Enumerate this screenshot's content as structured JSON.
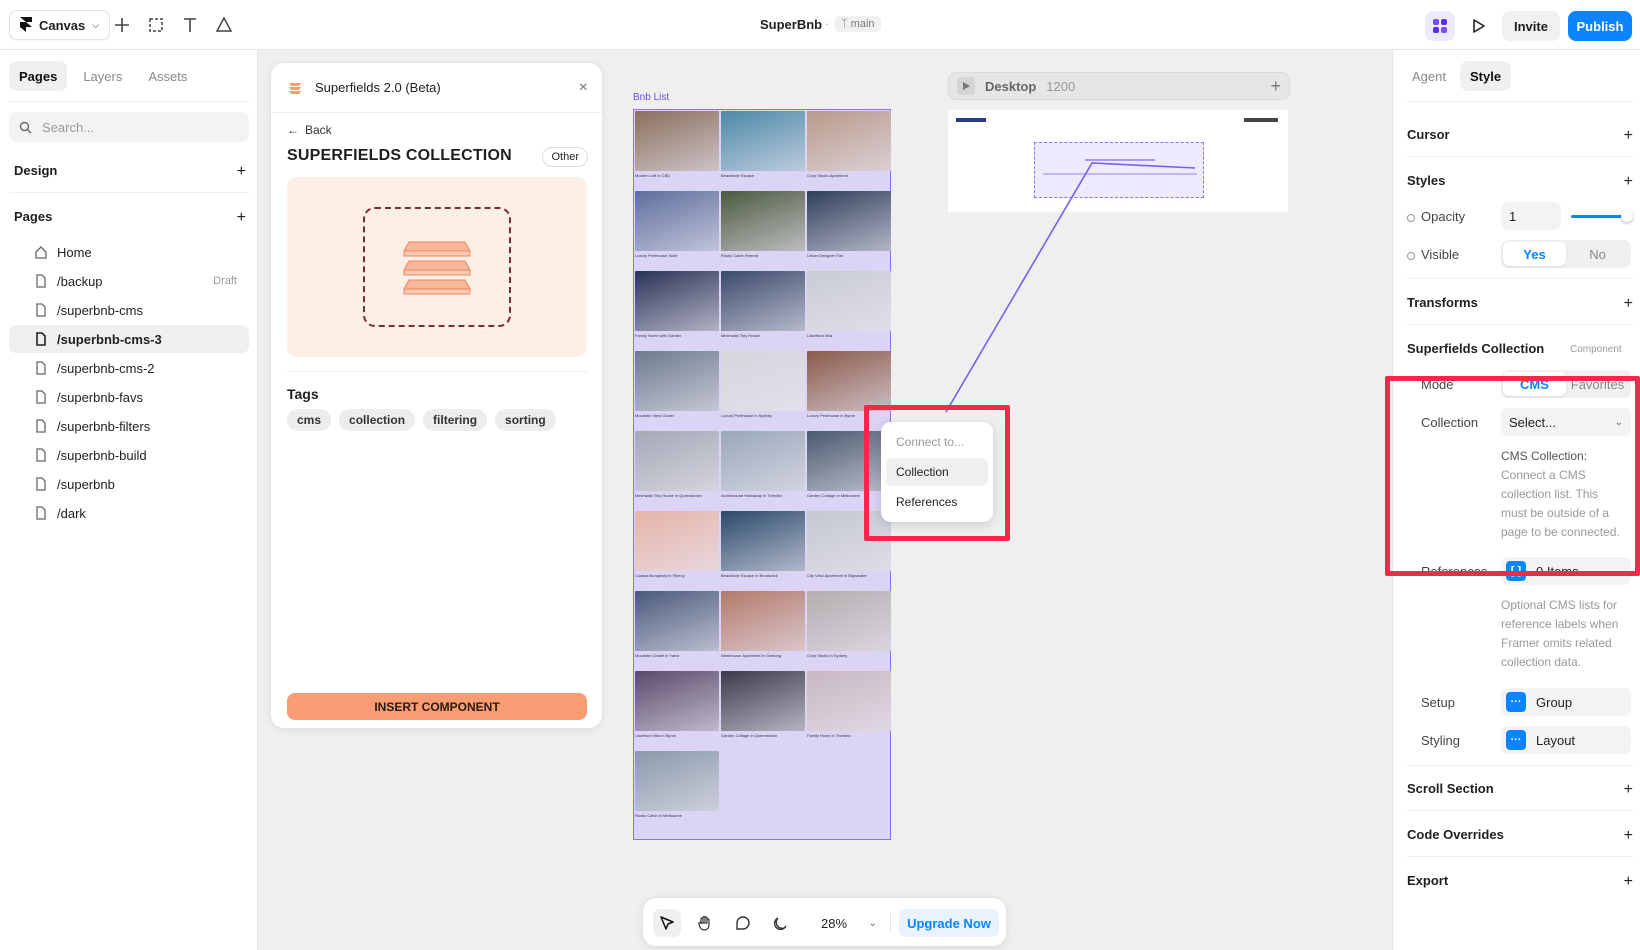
{
  "topbar": {
    "canvas_label": "Canvas",
    "project_title": "SuperBnb",
    "separator": "·",
    "branch": "main",
    "invite": "Invite",
    "publish": "Publish"
  },
  "left": {
    "tabs": [
      "Pages",
      "Layers",
      "Assets"
    ],
    "search_placeholder": "Search...",
    "design_label": "Design",
    "pages_label": "Pages",
    "pages": [
      {
        "label": "Home",
        "badge": ""
      },
      {
        "label": "/backup",
        "badge": "Draft"
      },
      {
        "label": "/superbnb-cms",
        "badge": ""
      },
      {
        "label": "/superbnb-cms-3",
        "badge": ""
      },
      {
        "label": "/superbnb-cms-2",
        "badge": ""
      },
      {
        "label": "/superbnb-favs",
        "badge": ""
      },
      {
        "label": "/superbnb-filters",
        "badge": ""
      },
      {
        "label": "/superbnb-build",
        "badge": ""
      },
      {
        "label": "/superbnb",
        "badge": ""
      },
      {
        "label": "/dark",
        "badge": ""
      }
    ]
  },
  "superfields": {
    "title": "Superfields 2.0 (Beta)",
    "back": "Back",
    "heading": "SUPERFIELDS COLLECTION",
    "category": "Other",
    "tags_label": "Tags",
    "tags": [
      "cms",
      "collection",
      "filtering",
      "sorting"
    ],
    "insert": "INSERT COMPONENT"
  },
  "canvas": {
    "bnb_label": "Bnb List",
    "cards": [
      {
        "title": "Modern Loft in CBD",
        "color": "#8a6f5c"
      },
      {
        "title": "Beachside Escape",
        "color": "#4d8aa8"
      },
      {
        "title": "Cozy Studio Apartment",
        "color": "#b99a8a"
      },
      {
        "title": "Luxury Penthouse Suite",
        "color": "#5e6f9c"
      },
      {
        "title": "Rustic Cabin Retreat",
        "color": "#4c5a3f"
      },
      {
        "title": "Urban Designer Flat",
        "color": "#2f3f5a"
      },
      {
        "title": "Family Home with Garden",
        "color": "#2a3355"
      },
      {
        "title": "Minimalist Tiny House",
        "color": "#3a4a6a"
      },
      {
        "title": "Lakefront Villa",
        "color": "#c9ccd4"
      },
      {
        "title": "Mountain View Chalet",
        "color": "#6d7c8c"
      },
      {
        "title": "Luxury Penthouse in Sydney",
        "color": "#d7d4dc"
      },
      {
        "title": "Luxury Penthouse in Byron",
        "color": "#8a5a4a"
      },
      {
        "title": "Minimalist Tiny House in Queenstown",
        "color": "#a4a9b4"
      },
      {
        "title": "Architectural Hideaway in Thredbo",
        "color": "#9aa8b8"
      },
      {
        "title": "Garden Cottage in Melbourne",
        "color": "#4a5a6e"
      },
      {
        "title": "Coastal Bungalow in Fitzroy",
        "color": "#e6b4a8"
      },
      {
        "title": "Beachside Escape in Brunswick",
        "color": "#2a4a6a"
      },
      {
        "title": "City View Apartment in Bayswater",
        "color": "#c4c8d0"
      },
      {
        "title": "Mountain Chalet in Yarra",
        "color": "#4a5a7a"
      },
      {
        "title": "Warehouse Apartment in Geelong",
        "color": "#b47a6a"
      },
      {
        "title": "Cozy Studio in Sydney",
        "color": "#b4aeb0"
      },
      {
        "title": "Lakefront Villa in Byron",
        "color": "#5a4a6a"
      },
      {
        "title": "Garden Cottage in Queenstown",
        "color": "#3a3a4a"
      },
      {
        "title": "Family Home in Thredbo",
        "color": "#c8b8c0"
      },
      {
        "title": "Rustic Cabin in Melbourne",
        "color": "#8a9aa8"
      }
    ],
    "desktop_label": "Desktop",
    "desktop_width": "1200"
  },
  "connect_menu": {
    "title": "Connect to...",
    "items": [
      "Collection",
      "References"
    ]
  },
  "bottom_toolbar": {
    "zoom": "28%",
    "upgrade": "Upgrade Now"
  },
  "right": {
    "tabs": [
      "Agent",
      "Style"
    ],
    "cursor": "Cursor",
    "styles": "Styles",
    "opacity_label": "Opacity",
    "opacity_value": "1",
    "visible_label": "Visible",
    "visible_options": [
      "Yes",
      "No"
    ],
    "transforms": "Transforms",
    "component_title": "Superfields Collection",
    "component_tag": "Component",
    "mode_label": "Mode",
    "mode_options": [
      "CMS",
      "Favorites"
    ],
    "collection_label": "Collection",
    "collection_value": "Select...",
    "cms_note": [
      "CMS Collection:",
      "Connect a CMS",
      "collection list. This",
      "must be outside of a",
      "page to be connected."
    ],
    "references_label": "References",
    "references_value": "0 Items",
    "references_note": [
      "Optional CMS lists for",
      "reference labels when",
      "Framer omits related",
      "collection data."
    ],
    "setup_label": "Setup",
    "setup_value": "Group",
    "styling_label": "Styling",
    "styling_value": "Layout",
    "scroll_section": "Scroll Section",
    "code_overrides": "Code Overrides",
    "export": "Export"
  },
  "colors": {
    "accent": "#0a85ff",
    "highlight": "#ef2b4b",
    "selection": "#8a73f0",
    "insert": "#f89c74"
  }
}
